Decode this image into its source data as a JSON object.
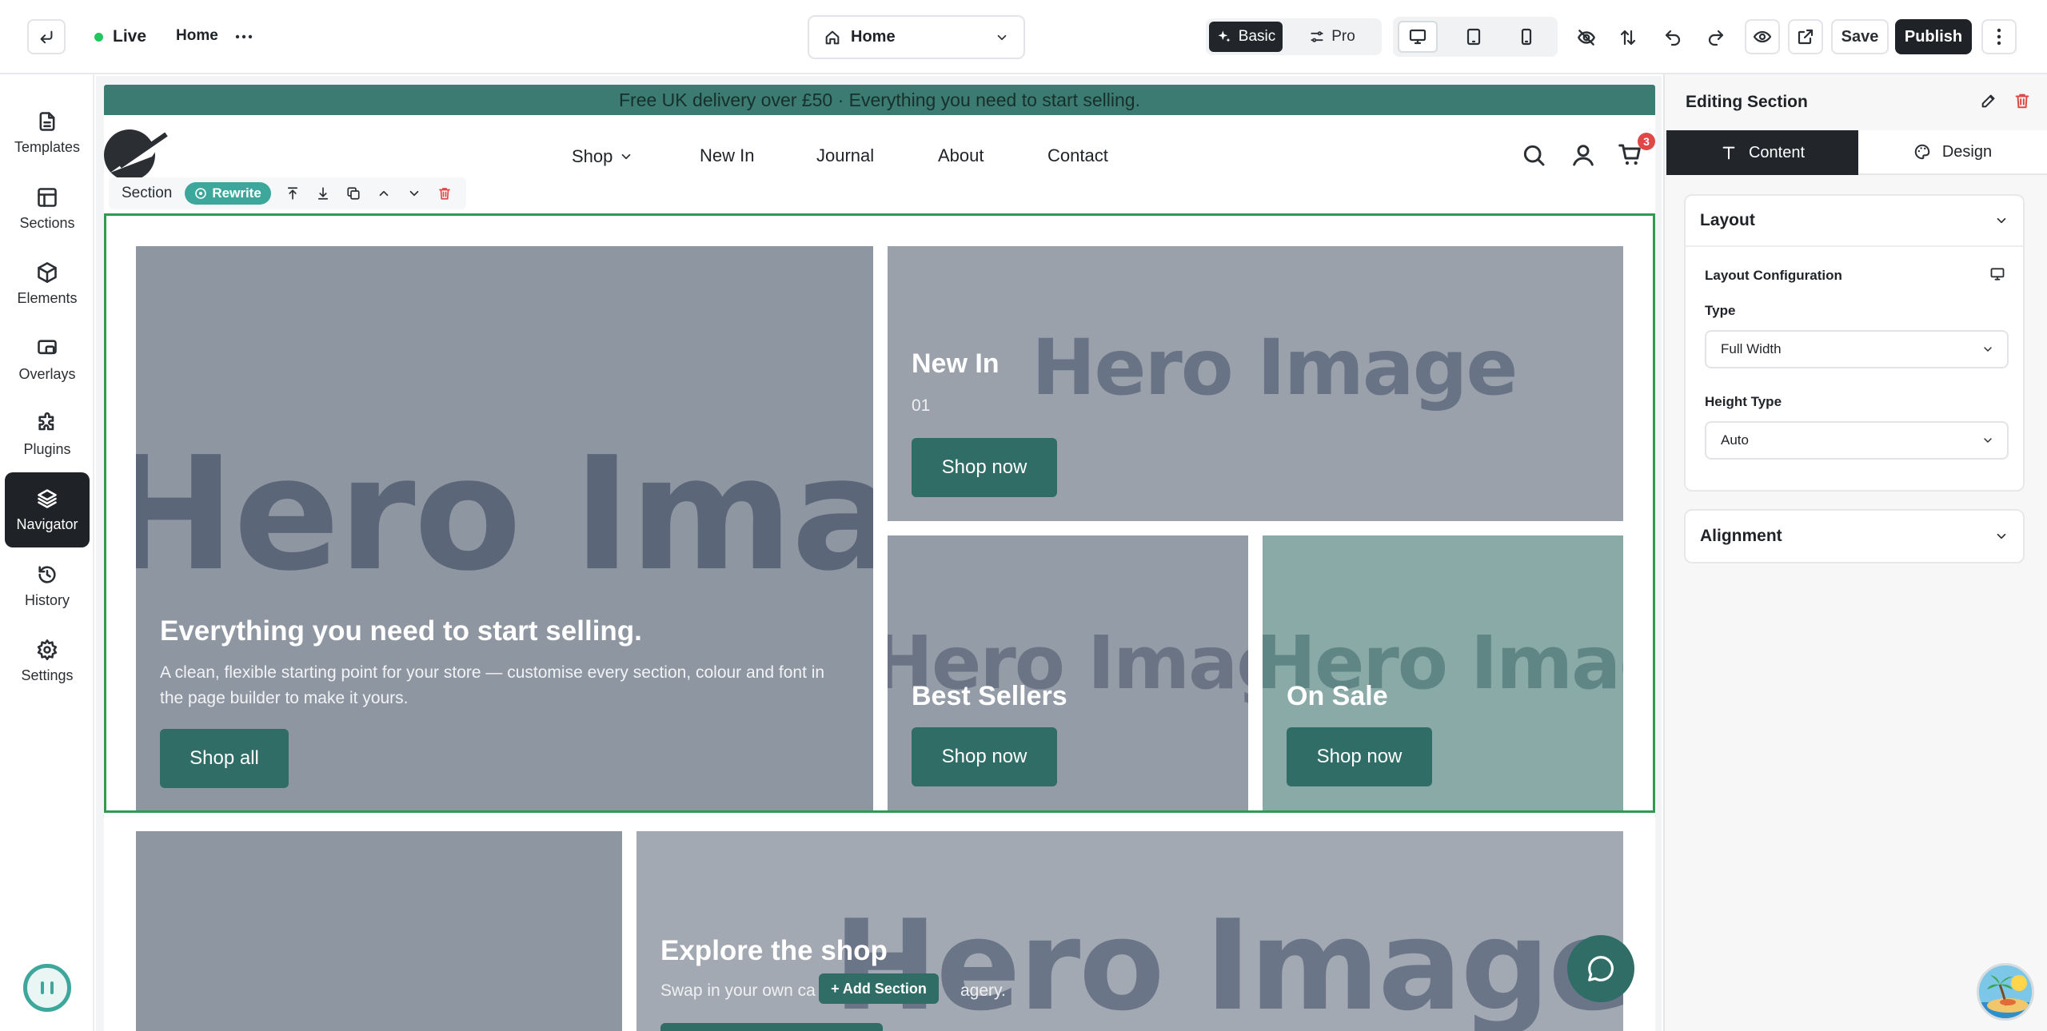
{
  "topbar": {
    "status_label": "Live",
    "page_breadcrumb": "Home",
    "page_selector": "Home",
    "mode_basic": "Basic",
    "mode_pro": "Pro",
    "save_label": "Save",
    "publish_label": "Publish"
  },
  "sidebar": {
    "items": [
      {
        "label": "Templates",
        "icon": "file-text-icon"
      },
      {
        "label": "Sections",
        "icon": "layout-icon"
      },
      {
        "label": "Elements",
        "icon": "cube-icon"
      },
      {
        "label": "Overlays",
        "icon": "overlay-icon"
      },
      {
        "label": "Plugins",
        "icon": "puzzle-icon"
      },
      {
        "label": "Navigator",
        "icon": "layers-icon"
      },
      {
        "label": "History",
        "icon": "history-icon"
      },
      {
        "label": "Settings",
        "icon": "gear-icon"
      }
    ]
  },
  "site": {
    "announcement": "Free UK delivery over £50 · Everything you need to start selling.",
    "nav": [
      "Shop",
      "New In",
      "Journal",
      "About",
      "Contact"
    ],
    "cart_count": "3",
    "hero_placeholder": "Hero Image",
    "hero": {
      "title": "Everything you need to start selling.",
      "body": "A clean, flexible starting point for your store — customise every section, colour and font in the page builder to make it yours.",
      "cta": "Shop all"
    },
    "tiles": [
      {
        "title": "New In",
        "subtitle": "01",
        "cta": "Shop now"
      },
      {
        "title": "Best Sellers",
        "cta": "Shop now"
      },
      {
        "title": "On Sale",
        "cta": "Shop now"
      }
    ],
    "explore": {
      "title": "Explore the shop",
      "body_start": "Swap in your own ca",
      "body_end": "agery."
    }
  },
  "section_toolbar": {
    "label": "Section",
    "rewrite": "Rewrite"
  },
  "add_section": "+ Add Section",
  "panel": {
    "title": "Editing Section",
    "tab_content": "Content",
    "tab_design": "Design",
    "layout": {
      "heading": "Layout",
      "config_label": "Layout Configuration",
      "type_label": "Type",
      "type_value": "Full Width",
      "height_label": "Height Type",
      "height_value": "Auto"
    },
    "alignment": {
      "heading": "Alignment"
    }
  },
  "colors": {
    "accent": "#2f6d66",
    "live": "#22c55e",
    "selection": "#2e9b4f",
    "sale_tile": "#8aaaa8",
    "danger": "#e04848"
  }
}
